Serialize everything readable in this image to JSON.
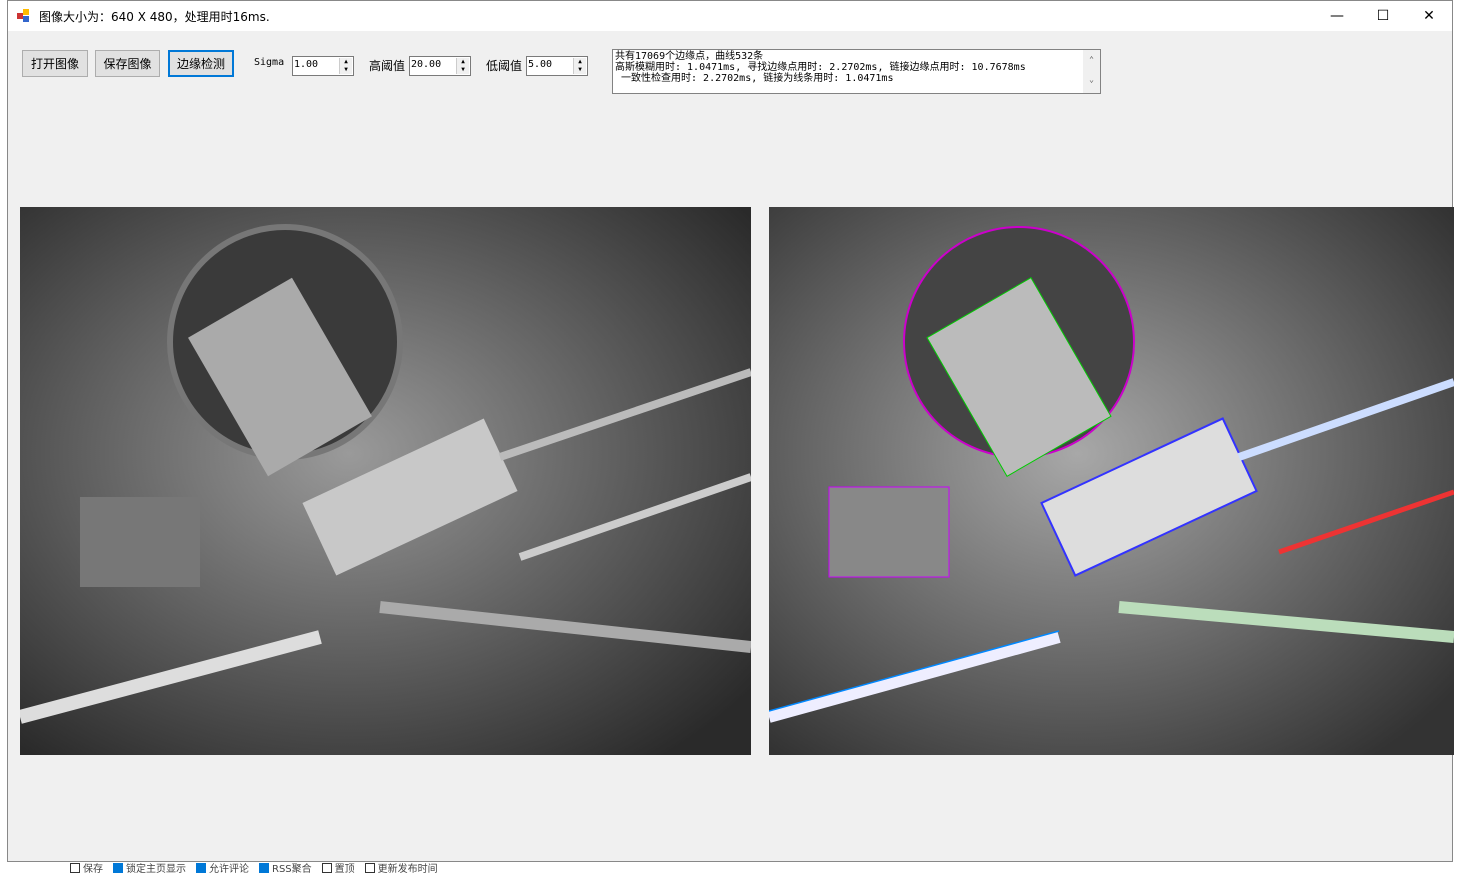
{
  "window": {
    "title": "图像大小为：640 X 480，处理用时16ms.",
    "minimize": "—",
    "maximize": "☐",
    "close": "✕"
  },
  "toolbar": {
    "open": "打开图像",
    "save": "保存图像",
    "detect": "边缘检测",
    "sigma_label": "Sigma",
    "sigma": "1.00",
    "high_label": "高阈值",
    "high": "20.00",
    "low_label": "低阈值",
    "low": "5.00"
  },
  "info": {
    "lines": [
      "共有17069个边缘点，曲线532条",
      "高斯模糊用时: 1.0471ms, 寻找边缘点用时: 2.2702ms, 链接边缘点用时: 10.7678ms",
      " 一致性检查用时: 2.2702ms, 链接为线条用时: 1.0471ms"
    ]
  },
  "bottom": [
    {
      "label": "保存",
      "checked": false
    },
    {
      "label": "锁定主页显示",
      "checked": true
    },
    {
      "label": "允许评论",
      "checked": true
    },
    {
      "label": "RSS聚合",
      "checked": true
    },
    {
      "label": "置顶",
      "checked": false
    },
    {
      "label": "更新发布时间",
      "checked": false
    }
  ]
}
